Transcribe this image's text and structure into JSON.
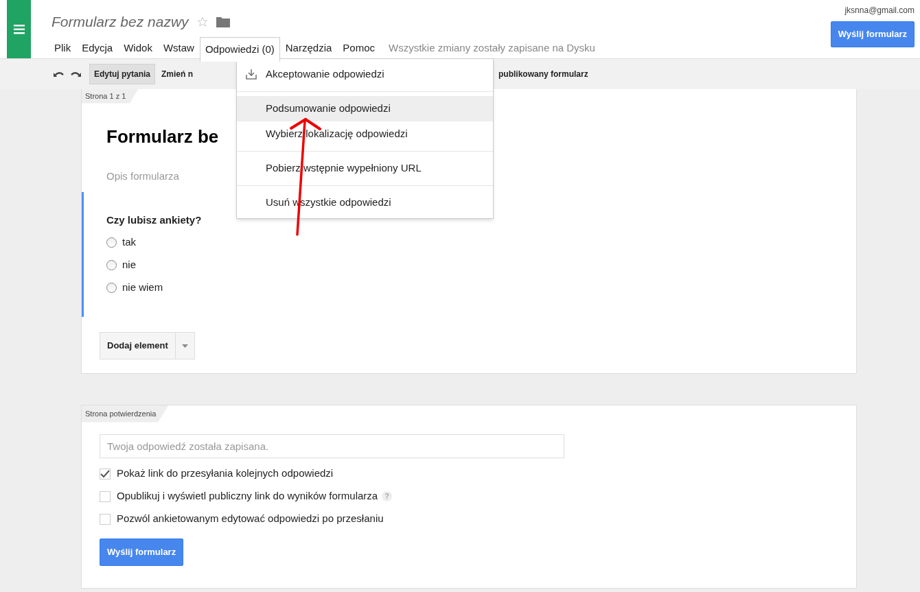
{
  "header": {
    "doc_title": "Formularz bez nazwy",
    "starred": false,
    "account": "jksnna@gmail.com",
    "send_button": "Wyślij formularz",
    "save_status": "Wszystkie zmiany zostały zapisane na Dysku"
  },
  "menu_bar": [
    {
      "label": "Plik",
      "open": false
    },
    {
      "label": "Edycja",
      "open": false
    },
    {
      "label": "Widok",
      "open": false
    },
    {
      "label": "Wstaw",
      "open": false
    },
    {
      "label": "Odpowiedzi (0)",
      "open": true
    },
    {
      "label": "Narzędzia",
      "open": false
    },
    {
      "label": "Pomoc",
      "open": false
    }
  ],
  "open_menu": {
    "sections": [
      {
        "items": [
          {
            "label": "Akceptowanie odpowiedzi",
            "kind": "icon",
            "highlighted": false
          }
        ]
      },
      {
        "items": [
          {
            "label": "Podsumowanie odpowiedzi",
            "kind": "plain",
            "highlighted": true
          },
          {
            "label": "Wybierz lokalizację odpowiedzi",
            "kind": "plain",
            "highlighted": false
          }
        ]
      },
      {
        "items": [
          {
            "label": "Pobierz wstępnie wypełniony URL",
            "kind": "plain",
            "highlighted": false
          }
        ]
      },
      {
        "items": [
          {
            "label": "Usuń wszystkie odpowiedzi",
            "kind": "plain",
            "highlighted": false
          }
        ]
      }
    ]
  },
  "toolbar": {
    "buttons": [
      {
        "label": "Edytuj pytania",
        "selected": true
      },
      {
        "label": "Zmień n",
        "selected": false
      }
    ],
    "trailing_text": "publikowany formularz"
  },
  "form_page": {
    "tab": "Strona 1 z 1",
    "title": "Formularz be",
    "description_placeholder": "Opis formularza",
    "question": {
      "title": "Czy lubisz ankiety?",
      "options": [
        {
          "label": "tak",
          "selected": false
        },
        {
          "label": "nie",
          "selected": false
        },
        {
          "label": "nie wiem",
          "selected": false
        }
      ]
    },
    "add_button": "Dodaj element"
  },
  "confirmation": {
    "tab": "Strona potwierdzenia",
    "message_placeholder": "Twoja odpowiedź została zapisana.",
    "options": [
      {
        "label": "Pokaż link do przesyłania kolejnych odpowiedzi",
        "checked": true
      },
      {
        "label": "Opublikuj i wyświetl publiczny link do wyników formularza",
        "checked": false,
        "help": "?"
      },
      {
        "label": "Pozwól ankietowanym edytować odpowiedzi po przesłaniu",
        "checked": false
      }
    ],
    "send_button": "Wyślij formularz"
  }
}
